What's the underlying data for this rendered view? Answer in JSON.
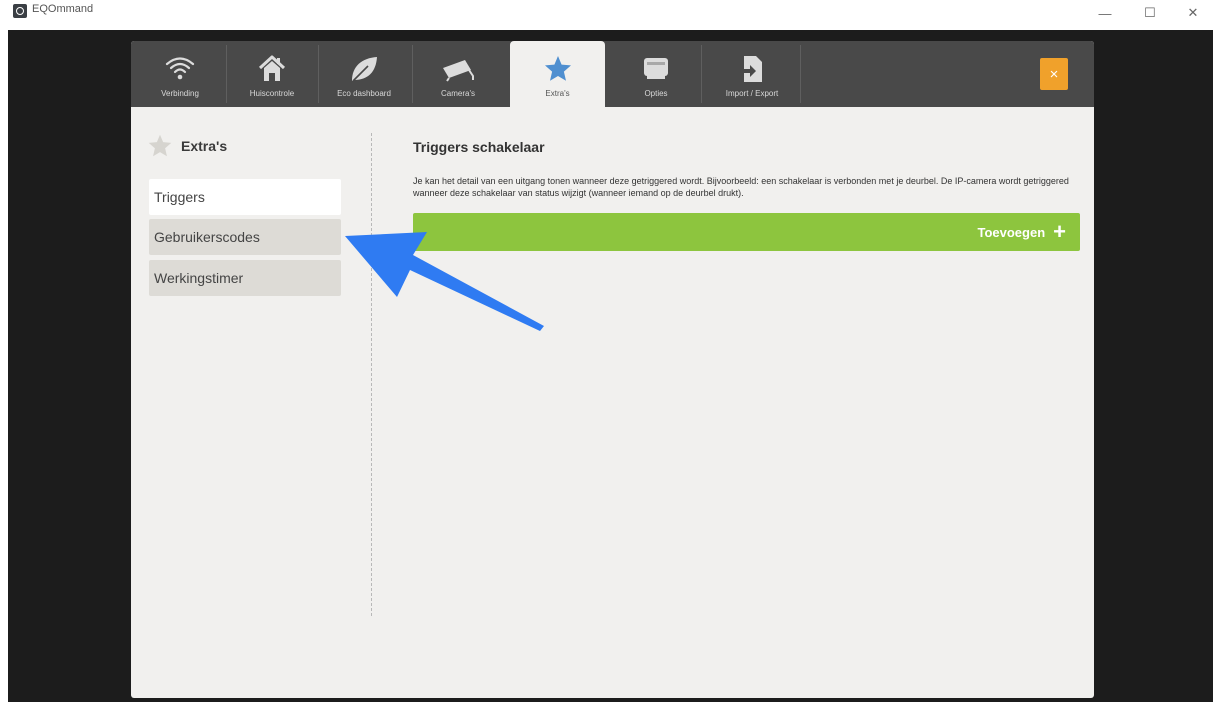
{
  "window": {
    "title": "EQOmmand",
    "minimize": "—",
    "maximize": "☐",
    "close": "✕"
  },
  "nav": {
    "tabs": [
      {
        "label": "Verbinding",
        "icon": "wifi-icon"
      },
      {
        "label": "Huiscontrole",
        "icon": "house-icon"
      },
      {
        "label": "Eco dashboard",
        "icon": "leaf-icon"
      },
      {
        "label": "Camera's",
        "icon": "camera-icon"
      },
      {
        "label": "Extra's",
        "icon": "star-icon",
        "active": true
      },
      {
        "label": "Opties",
        "icon": "windows-icon"
      },
      {
        "label": "Import / Export",
        "icon": "import-export-icon"
      }
    ],
    "close_label": "×",
    "accent": "#f0a12b"
  },
  "sidebar": {
    "title": "Extra's",
    "items": [
      {
        "label": "Triggers",
        "active": true
      },
      {
        "label": "Gebruikerscodes"
      },
      {
        "label": "Werkingstimer"
      }
    ]
  },
  "main": {
    "title": "Triggers schakelaar",
    "description": "Je kan het detail van een uitgang tonen wanneer deze getriggered wordt. Bijvoorbeeld: een schakelaar is verbonden met je deurbel. De IP-camera wordt getriggered wanneer deze schakelaar van status wijzigt (wanneer iemand op de deurbel drukt).",
    "add_label": "Toevoegen",
    "add_color": "#8dc53e"
  },
  "annotation": {
    "arrow_color": "#2f7bf2"
  }
}
